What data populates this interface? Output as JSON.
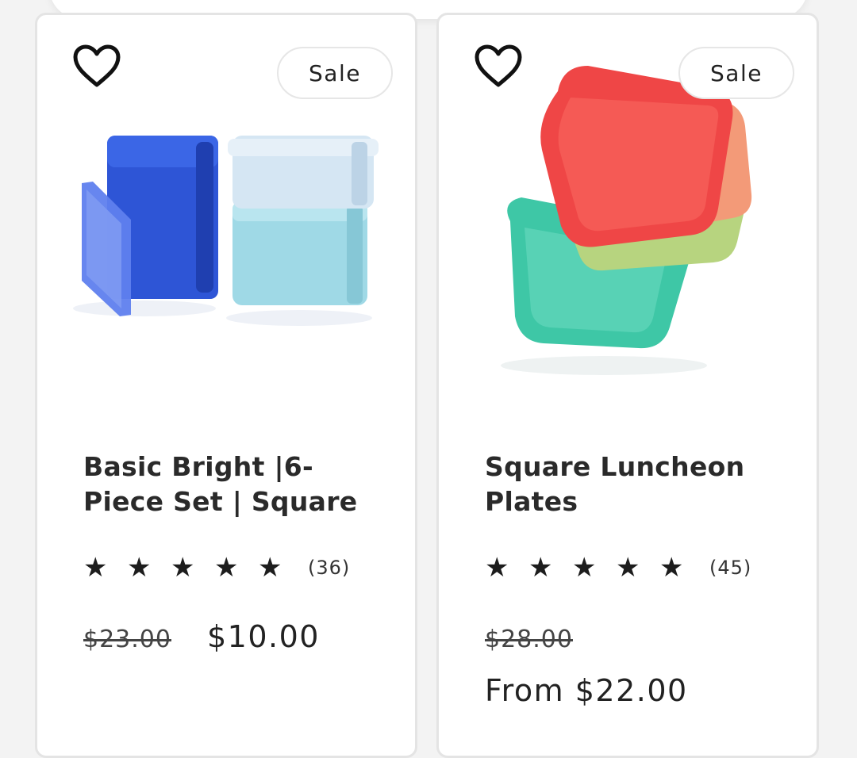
{
  "products": [
    {
      "badge": "Sale",
      "title": "Basic Bright |6-Piece Set | Square",
      "stars": [
        "★",
        "★",
        "★",
        "★",
        "★"
      ],
      "rating": 5,
      "review_count": "(36)",
      "old_price": "$23.00",
      "price": "$10.00",
      "image_icon": "blue-square-containers-image"
    },
    {
      "badge": "Sale",
      "title": "Square Luncheon Plates",
      "stars": [
        "★",
        "★",
        "★",
        "★",
        "★"
      ],
      "rating": 5,
      "review_count": "(45)",
      "old_price": "$28.00",
      "price": "From $22.00",
      "image_icon": "colorful-square-plates-image"
    }
  ],
  "icons": {
    "wishlist": "heart-outline-icon"
  },
  "colors": {
    "background": "#f3f3f3",
    "card": "#ffffff",
    "border": "#e4e4e4",
    "text": "#2a2a2a"
  }
}
